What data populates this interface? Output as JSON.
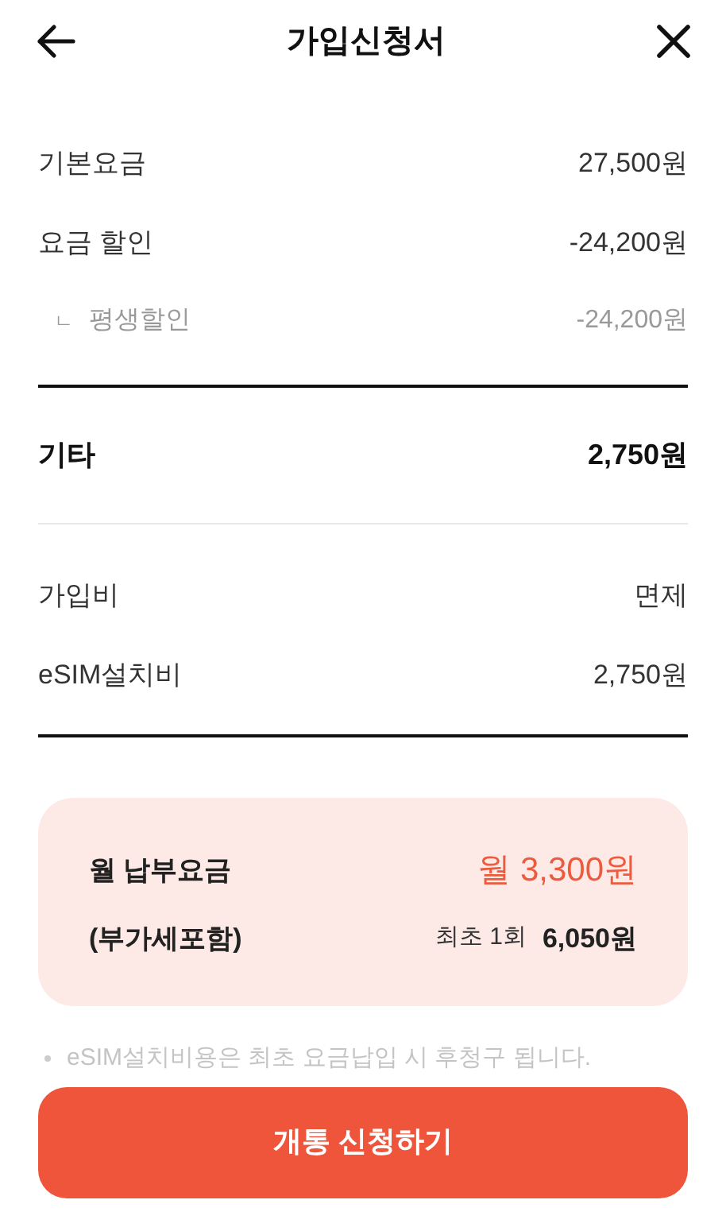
{
  "header": {
    "title": "가입신청서"
  },
  "fee_rows": [
    {
      "kind": "normal",
      "label": "기본요금",
      "value": "27,500원"
    },
    {
      "kind": "normal",
      "label": "요금 할인",
      "value": "-24,200원"
    },
    {
      "kind": "sub",
      "marker": "ㄴ",
      "label": "평생할인",
      "value": "-24,200원"
    }
  ],
  "other_total": {
    "label": "기타",
    "value": "2,750원"
  },
  "other_rows": [
    {
      "kind": "normal",
      "label": "가입비",
      "value": "면제"
    },
    {
      "kind": "normal",
      "label": "eSIM설치비",
      "value": "2,750원"
    }
  ],
  "summary": {
    "label": "월 납부요금",
    "sublabel": "(부가세포함)",
    "monthly": "월 3,300원",
    "first_label": "최초 1회",
    "first_value": "6,050원"
  },
  "notes": [
    "eSIM설치비용은 최초 요금납입 시 후청구 됩니다."
  ],
  "submit_button": "개통 신청하기"
}
